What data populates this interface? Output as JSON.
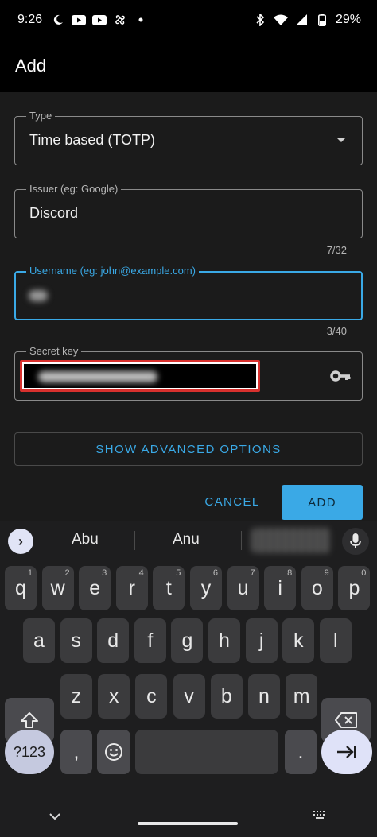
{
  "status": {
    "time": "9:26",
    "battery": "29%",
    "left_icons": [
      "moon-icon",
      "youtube-icon",
      "youtube-icon",
      "fan-icon",
      "dot-icon"
    ],
    "right_icons": [
      "bluetooth-icon",
      "wifi-icon",
      "signal-icon",
      "battery-icon"
    ]
  },
  "app": {
    "title": "Add"
  },
  "form": {
    "type": {
      "label": "Type",
      "value": "Time based (TOTP)"
    },
    "issuer": {
      "label": "Issuer (eg: Google)",
      "value": "Discord",
      "counter": "7/32"
    },
    "username": {
      "label": "Username (eg: john@example.com)",
      "value": "",
      "counter": "3/40"
    },
    "secret": {
      "label": "Secret key",
      "value": ""
    },
    "advanced_label": "SHOW ADVANCED OPTIONS",
    "cancel_label": "CANCEL",
    "add_label": "ADD"
  },
  "keyboard": {
    "suggestions": [
      "Abu",
      "Anu"
    ],
    "row1": [
      {
        "k": "q",
        "h": "1"
      },
      {
        "k": "w",
        "h": "2"
      },
      {
        "k": "e",
        "h": "3"
      },
      {
        "k": "r",
        "h": "4"
      },
      {
        "k": "t",
        "h": "5"
      },
      {
        "k": "y",
        "h": "6"
      },
      {
        "k": "u",
        "h": "7"
      },
      {
        "k": "i",
        "h": "8"
      },
      {
        "k": "o",
        "h": "9"
      },
      {
        "k": "p",
        "h": "0"
      }
    ],
    "row2": [
      "a",
      "s",
      "d",
      "f",
      "g",
      "h",
      "j",
      "k",
      "l"
    ],
    "row3": [
      "z",
      "x",
      "c",
      "v",
      "b",
      "n",
      "m"
    ],
    "symbols_label": "?123",
    "comma": ",",
    "period": "."
  },
  "colors": {
    "accent": "#3aa9e6",
    "highlight": "#d9312e",
    "background": "#1b1b1b"
  }
}
